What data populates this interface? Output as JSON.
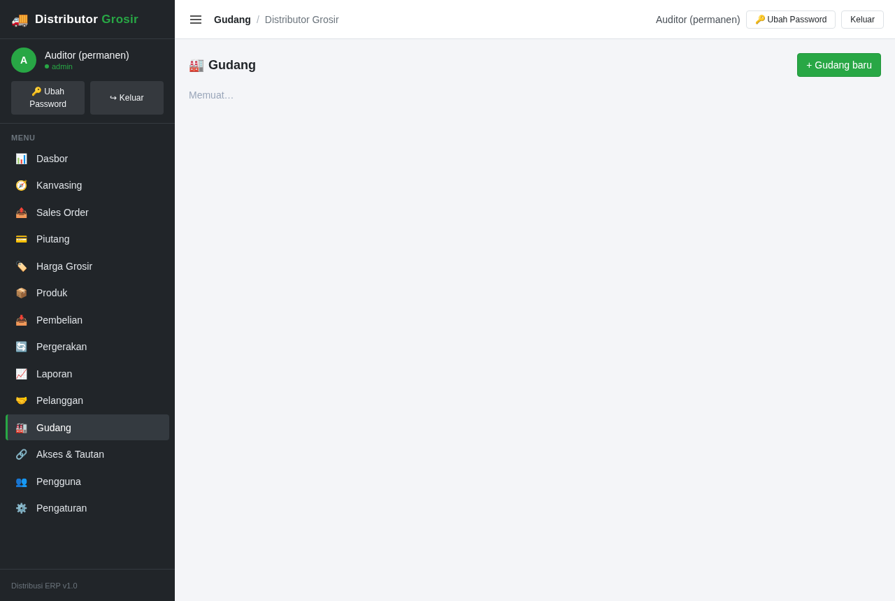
{
  "sidebar": {
    "brand": {
      "icon": "🚚",
      "title": "Distributor",
      "accent": "Grosir"
    },
    "user": {
      "avatar": "A",
      "name": "Auditor (permanen)",
      "role": "admin"
    },
    "buttons": [
      {
        "icon": "🔑",
        "label": "Ubah Password"
      },
      {
        "icon": "↪",
        "label": "Keluar"
      }
    ],
    "menu_label": "MENU",
    "items": [
      {
        "icon": "📊",
        "label": "Dasbor",
        "selected": false
      },
      {
        "icon": "🧭",
        "label": "Kanvasing",
        "selected": false
      },
      {
        "icon": "📤",
        "label": "Sales Order",
        "selected": false
      },
      {
        "icon": "💳",
        "label": "Piutang",
        "selected": false
      },
      {
        "icon": "🏷️",
        "label": "Harga Grosir",
        "selected": false
      },
      {
        "icon": "📦",
        "label": "Produk",
        "selected": false
      },
      {
        "icon": "📥",
        "label": "Pembelian",
        "selected": false
      },
      {
        "icon": "🔄",
        "label": "Pergerakan",
        "selected": false
      },
      {
        "icon": "📈",
        "label": "Laporan",
        "selected": false
      },
      {
        "icon": "🤝",
        "label": "Pelanggan",
        "selected": false
      },
      {
        "icon": "🏭",
        "label": "Gudang",
        "selected": true
      },
      {
        "icon": "🔗",
        "label": "Akses & Tautan",
        "selected": false
      },
      {
        "icon": "👥",
        "label": "Pengguna",
        "selected": false
      },
      {
        "icon": "⚙️",
        "label": "Pengaturan",
        "selected": false
      }
    ],
    "footer": "Distribusi ERP v1.0"
  },
  "header": {
    "breadcrumb": {
      "page": "Gudang",
      "separator": "/",
      "app": "Distributor Grosir"
    },
    "user": "Auditor (permanen)",
    "buttons": [
      {
        "icon": "🔑",
        "label": "Ubah Password"
      },
      {
        "label": "Keluar"
      }
    ]
  },
  "main": {
    "title": {
      "icon": "🏭",
      "text": "Gudang"
    },
    "new_button": "+ Gudang baru",
    "status": "Memuat…"
  }
}
